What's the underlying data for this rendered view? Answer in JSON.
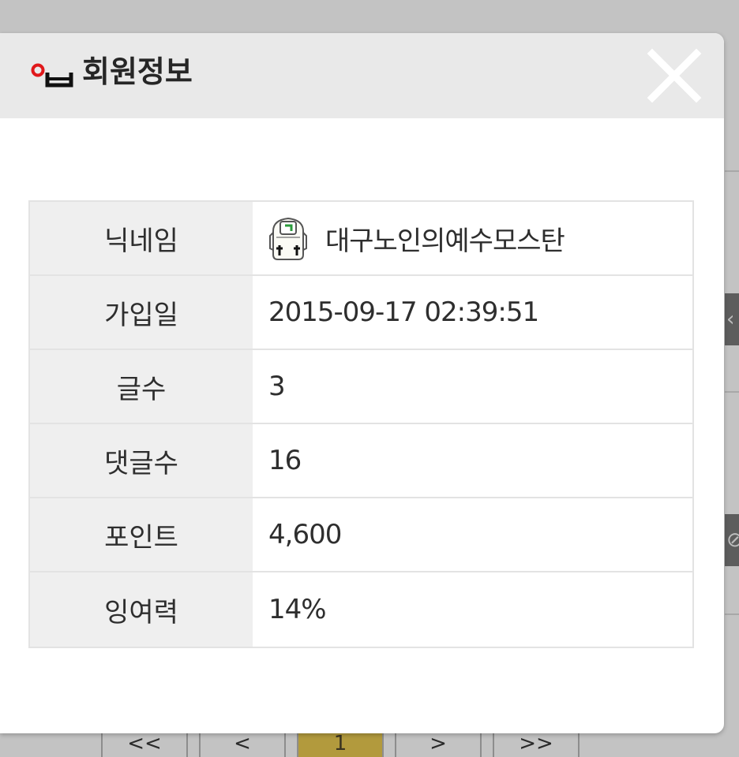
{
  "modal": {
    "title": "회원정보",
    "logo_icon": "member-info-logo",
    "close_icon": "close-icon"
  },
  "profile": {
    "rows": [
      {
        "label": "닉네임",
        "value": "대구노인의예수모스탄",
        "icon": "member-level-icon"
      },
      {
        "label": "가입일",
        "value": "2015-09-17 02:39:51"
      },
      {
        "label": "글수",
        "value": "3"
      },
      {
        "label": "댓글수",
        "value": "16"
      },
      {
        "label": "포인트",
        "value": "4,600"
      },
      {
        "label": "잉여력",
        "value": "14%"
      }
    ]
  },
  "background": {
    "pager": {
      "first": "<<",
      "prev": "<",
      "current": "1",
      "next": ">",
      "last": ">>"
    }
  },
  "colors": {
    "header_bg": "#e9e9e9",
    "label_bg": "#efefef",
    "accent_red": "#e0181b",
    "pager_active": "#b29a3d"
  }
}
